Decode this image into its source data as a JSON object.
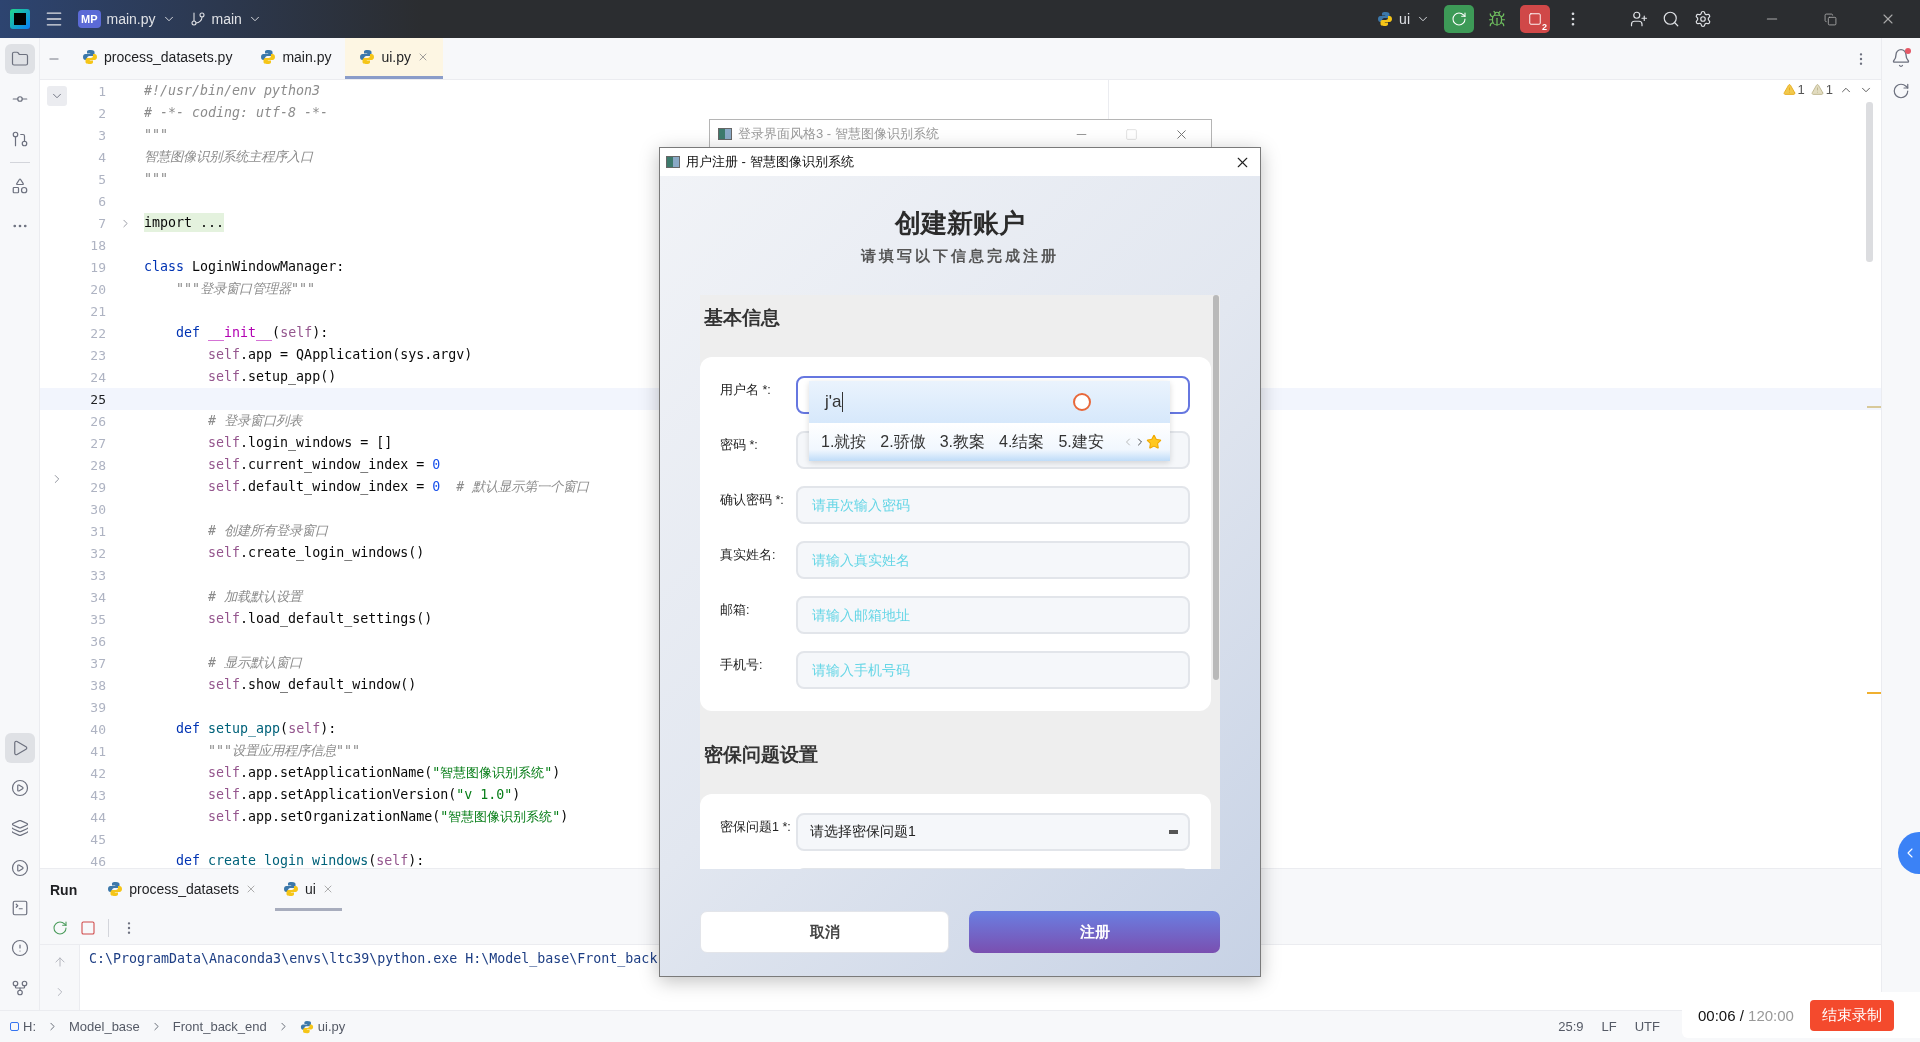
{
  "title_bar": {
    "project_badge": "MP",
    "project": "main.py",
    "branch": "main",
    "run_config": "ui",
    "stop_badge": "2"
  },
  "editor_tabs": [
    {
      "label": "process_datasets.py",
      "selected": false
    },
    {
      "label": "main.py",
      "selected": false
    },
    {
      "label": "ui.py",
      "selected": true
    }
  ],
  "inspections": {
    "warnings": "1",
    "weak_warnings": "1"
  },
  "code_lines": [
    {
      "number": "1",
      "current": false,
      "tokens": [
        {
          "kind": "comment",
          "text": "#!/usr/bin/env python3"
        }
      ]
    },
    {
      "number": "2",
      "current": false,
      "tokens": [
        {
          "kind": "comment",
          "text": "# -*- coding: utf-8 -*-"
        }
      ]
    },
    {
      "number": "3",
      "current": false,
      "tokens": [
        {
          "kind": "doc",
          "text": "\"\"\""
        }
      ]
    },
    {
      "number": "4",
      "current": false,
      "tokens": [
        {
          "kind": "doc",
          "text": "智慧图像识别系统主程序入口"
        }
      ]
    },
    {
      "number": "5",
      "current": false,
      "tokens": [
        {
          "kind": "doc",
          "text": "\"\"\""
        }
      ]
    },
    {
      "number": "6",
      "current": false
    },
    {
      "number": "7",
      "current": false,
      "tokens": [
        {
          "kind": "folded",
          "text": "import ..."
        }
      ]
    },
    {
      "number": "18",
      "current": false
    },
    {
      "number": "19",
      "current": false,
      "tokens": [
        {
          "kind": "keyword",
          "text": "class"
        },
        {
          "kind": "plain",
          "text": " LoginWindowManager:"
        }
      ]
    },
    {
      "number": "20",
      "current": false,
      "tokens": [
        {
          "kind": "doc",
          "text": "    \"\"\"登录窗口管理器\"\"\""
        }
      ]
    },
    {
      "number": "21",
      "current": false
    },
    {
      "number": "22",
      "current": false,
      "tokens": [
        {
          "kind": "keyword",
          "text": "    def"
        },
        {
          "kind": "magic",
          "text": " __init__"
        },
        {
          "kind": "plain",
          "text": "("
        },
        {
          "kind": "self",
          "text": "self"
        },
        {
          "kind": "plain",
          "text": "):"
        }
      ]
    },
    {
      "number": "23",
      "current": false,
      "tokens": [
        {
          "kind": "self",
          "text": "        self"
        },
        {
          "kind": "plain",
          "text": ".app = QApplication(sys.argv)"
        }
      ]
    },
    {
      "number": "24",
      "current": false,
      "tokens": [
        {
          "kind": "self",
          "text": "        self"
        },
        {
          "kind": "plain",
          "text": ".setup_app()"
        }
      ]
    },
    {
      "number": "25",
      "current": true
    },
    {
      "number": "26",
      "current": false,
      "tokens": [
        {
          "kind": "comment",
          "text": "        # 登录窗口列表"
        }
      ]
    },
    {
      "number": "27",
      "current": false,
      "tokens": [
        {
          "kind": "self",
          "text": "        self"
        },
        {
          "kind": "plain",
          "text": ".login_windows = []"
        }
      ]
    },
    {
      "number": "28",
      "current": false,
      "tokens": [
        {
          "kind": "self",
          "text": "        self"
        },
        {
          "kind": "plain",
          "text": ".current_window_index = "
        },
        {
          "kind": "number",
          "text": "0"
        }
      ]
    },
    {
      "number": "29",
      "current": false,
      "tokens": [
        {
          "kind": "self",
          "text": "        self"
        },
        {
          "kind": "plain",
          "text": ".default_window_index = "
        },
        {
          "kind": "number",
          "text": "0"
        },
        {
          "kind": "comment",
          "text": "  # 默认显示第一个窗口"
        }
      ]
    },
    {
      "number": "30",
      "current": false
    },
    {
      "number": "31",
      "current": false,
      "tokens": [
        {
          "kind": "comment",
          "text": "        # 创建所有登录窗口"
        }
      ]
    },
    {
      "number": "32",
      "current": false,
      "tokens": [
        {
          "kind": "self",
          "text": "        self"
        },
        {
          "kind": "plain",
          "text": ".create_login_windows()"
        }
      ]
    },
    {
      "number": "33",
      "current": false
    },
    {
      "number": "34",
      "current": false,
      "tokens": [
        {
          "kind": "comment",
          "text": "        # 加载默认设置"
        }
      ]
    },
    {
      "number": "35",
      "current": false,
      "tokens": [
        {
          "kind": "self",
          "text": "        self"
        },
        {
          "kind": "plain",
          "text": ".load_default_settings()"
        }
      ]
    },
    {
      "number": "36",
      "current": false
    },
    {
      "number": "37",
      "current": false,
      "tokens": [
        {
          "kind": "comment",
          "text": "        # 显示默认窗口"
        }
      ]
    },
    {
      "number": "38",
      "current": false,
      "tokens": [
        {
          "kind": "self",
          "text": "        self"
        },
        {
          "kind": "plain",
          "text": ".show_default_window()"
        }
      ]
    },
    {
      "number": "39",
      "current": false
    },
    {
      "number": "40",
      "current": false,
      "tokens": [
        {
          "kind": "keyword",
          "text": "    def"
        },
        {
          "kind": "func",
          "text": " setup_app"
        },
        {
          "kind": "plain",
          "text": "("
        },
        {
          "kind": "self",
          "text": "self"
        },
        {
          "kind": "plain",
          "text": "):"
        }
      ]
    },
    {
      "number": "41",
      "current": false,
      "tokens": [
        {
          "kind": "doc",
          "text": "        \"\"\"设置应用程序信息\"\"\""
        }
      ]
    },
    {
      "number": "42",
      "current": false,
      "tokens": [
        {
          "kind": "self",
          "text": "        self"
        },
        {
          "kind": "plain",
          "text": ".app.setApplicationName("
        },
        {
          "kind": "string",
          "text": "\"智慧图像识别系统\""
        },
        {
          "kind": "plain",
          "text": ")"
        }
      ]
    },
    {
      "number": "43",
      "current": false,
      "tokens": [
        {
          "kind": "self",
          "text": "        self"
        },
        {
          "kind": "plain",
          "text": ".app.setApplicationVersion("
        },
        {
          "kind": "string",
          "text": "\"v 1.0\""
        },
        {
          "kind": "plain",
          "text": ")"
        }
      ]
    },
    {
      "number": "44",
      "current": false,
      "tokens": [
        {
          "kind": "self",
          "text": "        self"
        },
        {
          "kind": "plain",
          "text": ".app.setOrganizationName("
        },
        {
          "kind": "string",
          "text": "\"智慧图像识别系统\""
        },
        {
          "kind": "plain",
          "text": ")"
        }
      ]
    },
    {
      "number": "45",
      "current": false
    },
    {
      "number": "46",
      "current": false,
      "tokens": [
        {
          "kind": "keyword",
          "text": "    def"
        },
        {
          "kind": "func",
          "text": " create_login_windows"
        },
        {
          "kind": "plain",
          "text": "("
        },
        {
          "kind": "self",
          "text": "self"
        },
        {
          "kind": "plain",
          "text": "):"
        }
      ]
    }
  ],
  "run_panel": {
    "title": "Run",
    "tabs": [
      {
        "label": "process_datasets",
        "selected": false
      },
      {
        "label": "ui",
        "selected": true
      }
    ],
    "output": "C:\\ProgramData\\Anaconda3\\envs\\ltc39\\python.exe H:\\Model_base\\Front_back"
  },
  "status_bar": {
    "breadcrumbs": [
      "H:",
      "Model_base",
      "Front_back_end",
      "ui.py"
    ],
    "position": "25:9",
    "line_ending": "LF",
    "encoding": "UTF"
  },
  "recorder": {
    "elapsed": "00:06",
    "separator": "/",
    "limit": "120:00",
    "stop_button": "结束录制"
  },
  "background_window": {
    "title": "登录界面风格3 - 智慧图像识别系统"
  },
  "dialog": {
    "title": "用户注册 - 智慧图像识别系统",
    "heading": "创建新账户",
    "subtitle": "请填写以下信息完成注册",
    "sections": [
      {
        "title": "基本信息",
        "fields": [
          {
            "kind": "text",
            "label": "用户名 *:",
            "focused": true
          },
          {
            "kind": "text",
            "label": "密码 *:",
            "focused": false
          },
          {
            "kind": "text",
            "label": "确认密码 *:",
            "placeholder": "请再次输入密码",
            "focused": false
          },
          {
            "kind": "text",
            "label": "真实姓名:",
            "placeholder": "请输入真实姓名",
            "focused": false
          },
          {
            "kind": "text",
            "label": "邮箱:",
            "placeholder": "请输入邮箱地址",
            "focused": false
          },
          {
            "kind": "text",
            "label": "手机号:",
            "placeholder": "请输入手机号码",
            "focused": false
          }
        ]
      },
      {
        "title": "密保问题设置",
        "fields": [
          {
            "kind": "select",
            "label": "密保问题1 *:",
            "value": "请选择密保问题1",
            "focused": false
          },
          {
            "kind": "select"
          }
        ]
      }
    ],
    "buttons": [
      {
        "kind": "secondary",
        "label": "取消"
      },
      {
        "kind": "primary",
        "label": "注册"
      }
    ]
  },
  "ime_popup": {
    "composition": "j'a",
    "candidates": [
      "1.就按",
      "2.骄傲",
      "3.教案",
      "4.结案",
      "5.建安"
    ]
  }
}
